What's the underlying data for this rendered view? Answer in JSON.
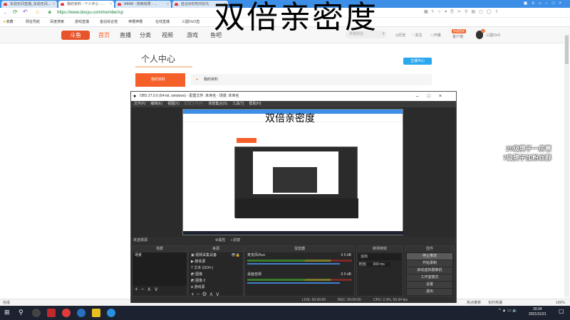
{
  "overlay_title": "双倍亲密度",
  "browser": {
    "tabs": [
      {
        "label": "永劫无间直播_永劫无间..."
      },
      {
        "label": "我的资料 - 个人中心 - ..."
      },
      {
        "label": "ABAB - 搜索结果 - ..."
      },
      {
        "label": "蓝台好的吃鸡好礼"
      }
    ],
    "url": "https://www.douyu.com/member/cp",
    "bookmarks": [
      "收藏",
      "网址导航",
      "百度搜索",
      "游戏直播",
      "金站综合馆",
      "神槽神槽",
      "在线直播",
      "三圆OvO直"
    ],
    "status": "完成",
    "status_right": [
      "热点推荐",
      "实时热播",
      "100%"
    ]
  },
  "douyu": {
    "nav": [
      "首页",
      "直播",
      "分类",
      "视频",
      "游戏",
      "鱼吧"
    ],
    "search_placeholder": "英雄联盟",
    "header_links": [
      "历史",
      "关注",
      "开播",
      "客户端",
      "三圆OvO"
    ],
    "client_badge": "快速登录",
    "avatar_badge": "17",
    "page_title": "个人中心",
    "anchor_center": "主播中心",
    "sidebar_active": "我的资料",
    "tab_label": "我的资料"
  },
  "overlay_side": [
    "20级牌子一房管",
    "7级牌子加粉丝群"
  ],
  "obs": {
    "title": "OBS 27.0.0 (64-bit, windows) - 配置文件: 未命名 - 场景: 未命名",
    "menu": [
      "文件(F)",
      "编辑(E)",
      "视图(V)",
      "配置文件(P)",
      "场景集合(S)",
      "工具(T)",
      "帮助(H)"
    ],
    "no_source": "未选择源",
    "props": "属性",
    "filters": "滤镜",
    "docks": {
      "scenes": "场景",
      "sources": "来源",
      "mixer": "混音器",
      "transitions": "转场特效",
      "controls": "控件"
    },
    "scenes": [
      "场景"
    ],
    "sources": [
      "视频采集设备",
      "媒体源",
      "文本 (GDI+)",
      "图像",
      "图像 2",
      "游戏源"
    ],
    "mixer": [
      {
        "name": "麦克风/Aux",
        "db": "0.0 dB"
      },
      {
        "name": "桌面音频",
        "db": "0.0 dB"
      }
    ],
    "transition": {
      "type": "淡出",
      "duration_label": "时长",
      "duration": "300 ms"
    },
    "controls": [
      "停止推流",
      "开始录制",
      "启动虚拟摄像机",
      "工作室模式",
      "设置",
      "退出"
    ],
    "status": {
      "live": "LIVE: 00:00:00",
      "rec": "REC: 00:00:00",
      "cpu": "CPU: 2.3%, 59.94 fps"
    }
  },
  "taskbar": {
    "time": "20:34",
    "date": "2021/11/21"
  }
}
